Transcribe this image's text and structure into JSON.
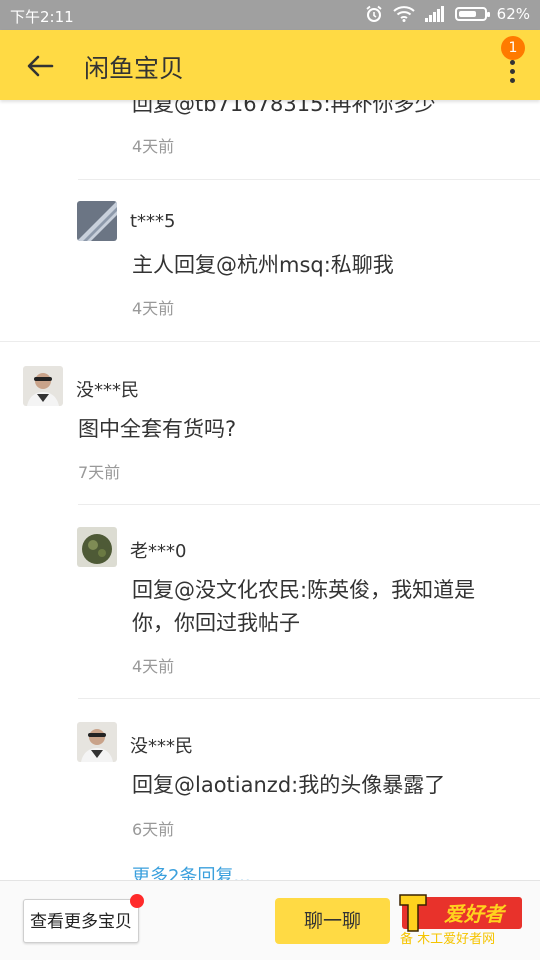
{
  "status": {
    "time": "下午2:11",
    "battery": "62%",
    "battery_level": 0.62
  },
  "header": {
    "title": "闲鱼宝贝",
    "badge": "1"
  },
  "comments": [
    {
      "text": "回复@tb71678315:再补你多少",
      "time": "4天前"
    },
    {
      "user": "t***5",
      "text": "主人回复@杭州msq:私聊我",
      "time": "4天前"
    },
    {
      "user": "没***民",
      "text": "图中全套有货吗?",
      "time": "7天前"
    },
    {
      "user": "老***0",
      "text_line1": "回复@没文化农民:陈英俊，我知道是",
      "text_line2": "你，你回过我帖子",
      "time": "4天前"
    },
    {
      "user": "没***民",
      "text": "回复@laotianzd:我的头像暴露了",
      "time": "6天前"
    }
  ],
  "more_replies": "更多2条回复...",
  "bottom": {
    "more_items": "查看更多宝贝",
    "chat": "聊一聊",
    "ad_text": "爱好者",
    "ad_subtext": "备 木工爱好者网"
  },
  "colors": {
    "accent": "#ffda44",
    "link": "#3ba0dd",
    "badge": "#ff7a00"
  }
}
